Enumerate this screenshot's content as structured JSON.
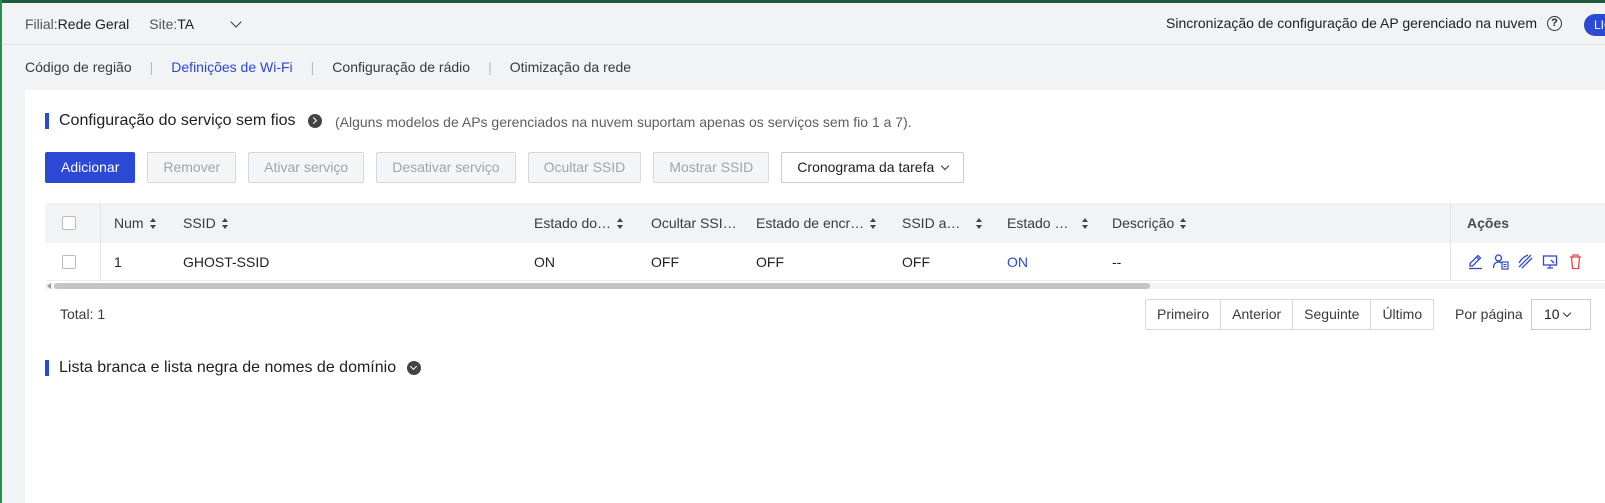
{
  "header": {
    "filial_label": "Filial:",
    "filial_value": "Rede Geral",
    "site_label": "Site:",
    "site_value": "TA",
    "sync_text": "Sincronização de configuração de AP gerenciado na nuvem",
    "help_glyph": "?",
    "badge": "LIG"
  },
  "tabs": [
    {
      "label": "Código de região",
      "active": false
    },
    {
      "label": "Definições de Wi-Fi",
      "active": true
    },
    {
      "label": "Configuração de rádio",
      "active": false
    },
    {
      "label": "Otimização da rede",
      "active": false
    }
  ],
  "wireless": {
    "title": "Configuração do serviço sem fios",
    "note": "(Alguns modelos de APs gerenciados na nuvem suportam apenas os serviços sem fio 1 a 7).",
    "toolbar": {
      "add": "Adicionar",
      "remove": "Remover",
      "enable": "Ativar serviço",
      "disable": "Desativar serviço",
      "hide_ssid": "Ocultar SSID",
      "show_ssid": "Mostrar SSID",
      "schedule": "Cronograma da tarefa"
    },
    "columns": {
      "num": "Num",
      "ssid": "SSID",
      "state": "Estado do…",
      "hide": "Ocultar SSI…",
      "encryption": "Estado de encr…",
      "ssid_a": "SSID a…",
      "status": "Estado …",
      "description": "Descrição",
      "actions": "Ações"
    },
    "rows": [
      {
        "num": "1",
        "ssid": "GHOST-SSID",
        "state": "ON",
        "hide": "OFF",
        "encryption": "OFF",
        "ssid_a": "OFF",
        "status": "ON",
        "description": "--"
      }
    ],
    "total": "Total: 1",
    "pager": {
      "first": "Primeiro",
      "prev": "Anterior",
      "next": "Seguinte",
      "last": "Último",
      "per_page_label": "Por página",
      "per_page_value": "10"
    }
  },
  "domain_list": {
    "title": "Lista branca e lista negra de nomes de domínio"
  },
  "colors": {
    "accent": "#2c49d6",
    "icon_red": "#e04848"
  }
}
